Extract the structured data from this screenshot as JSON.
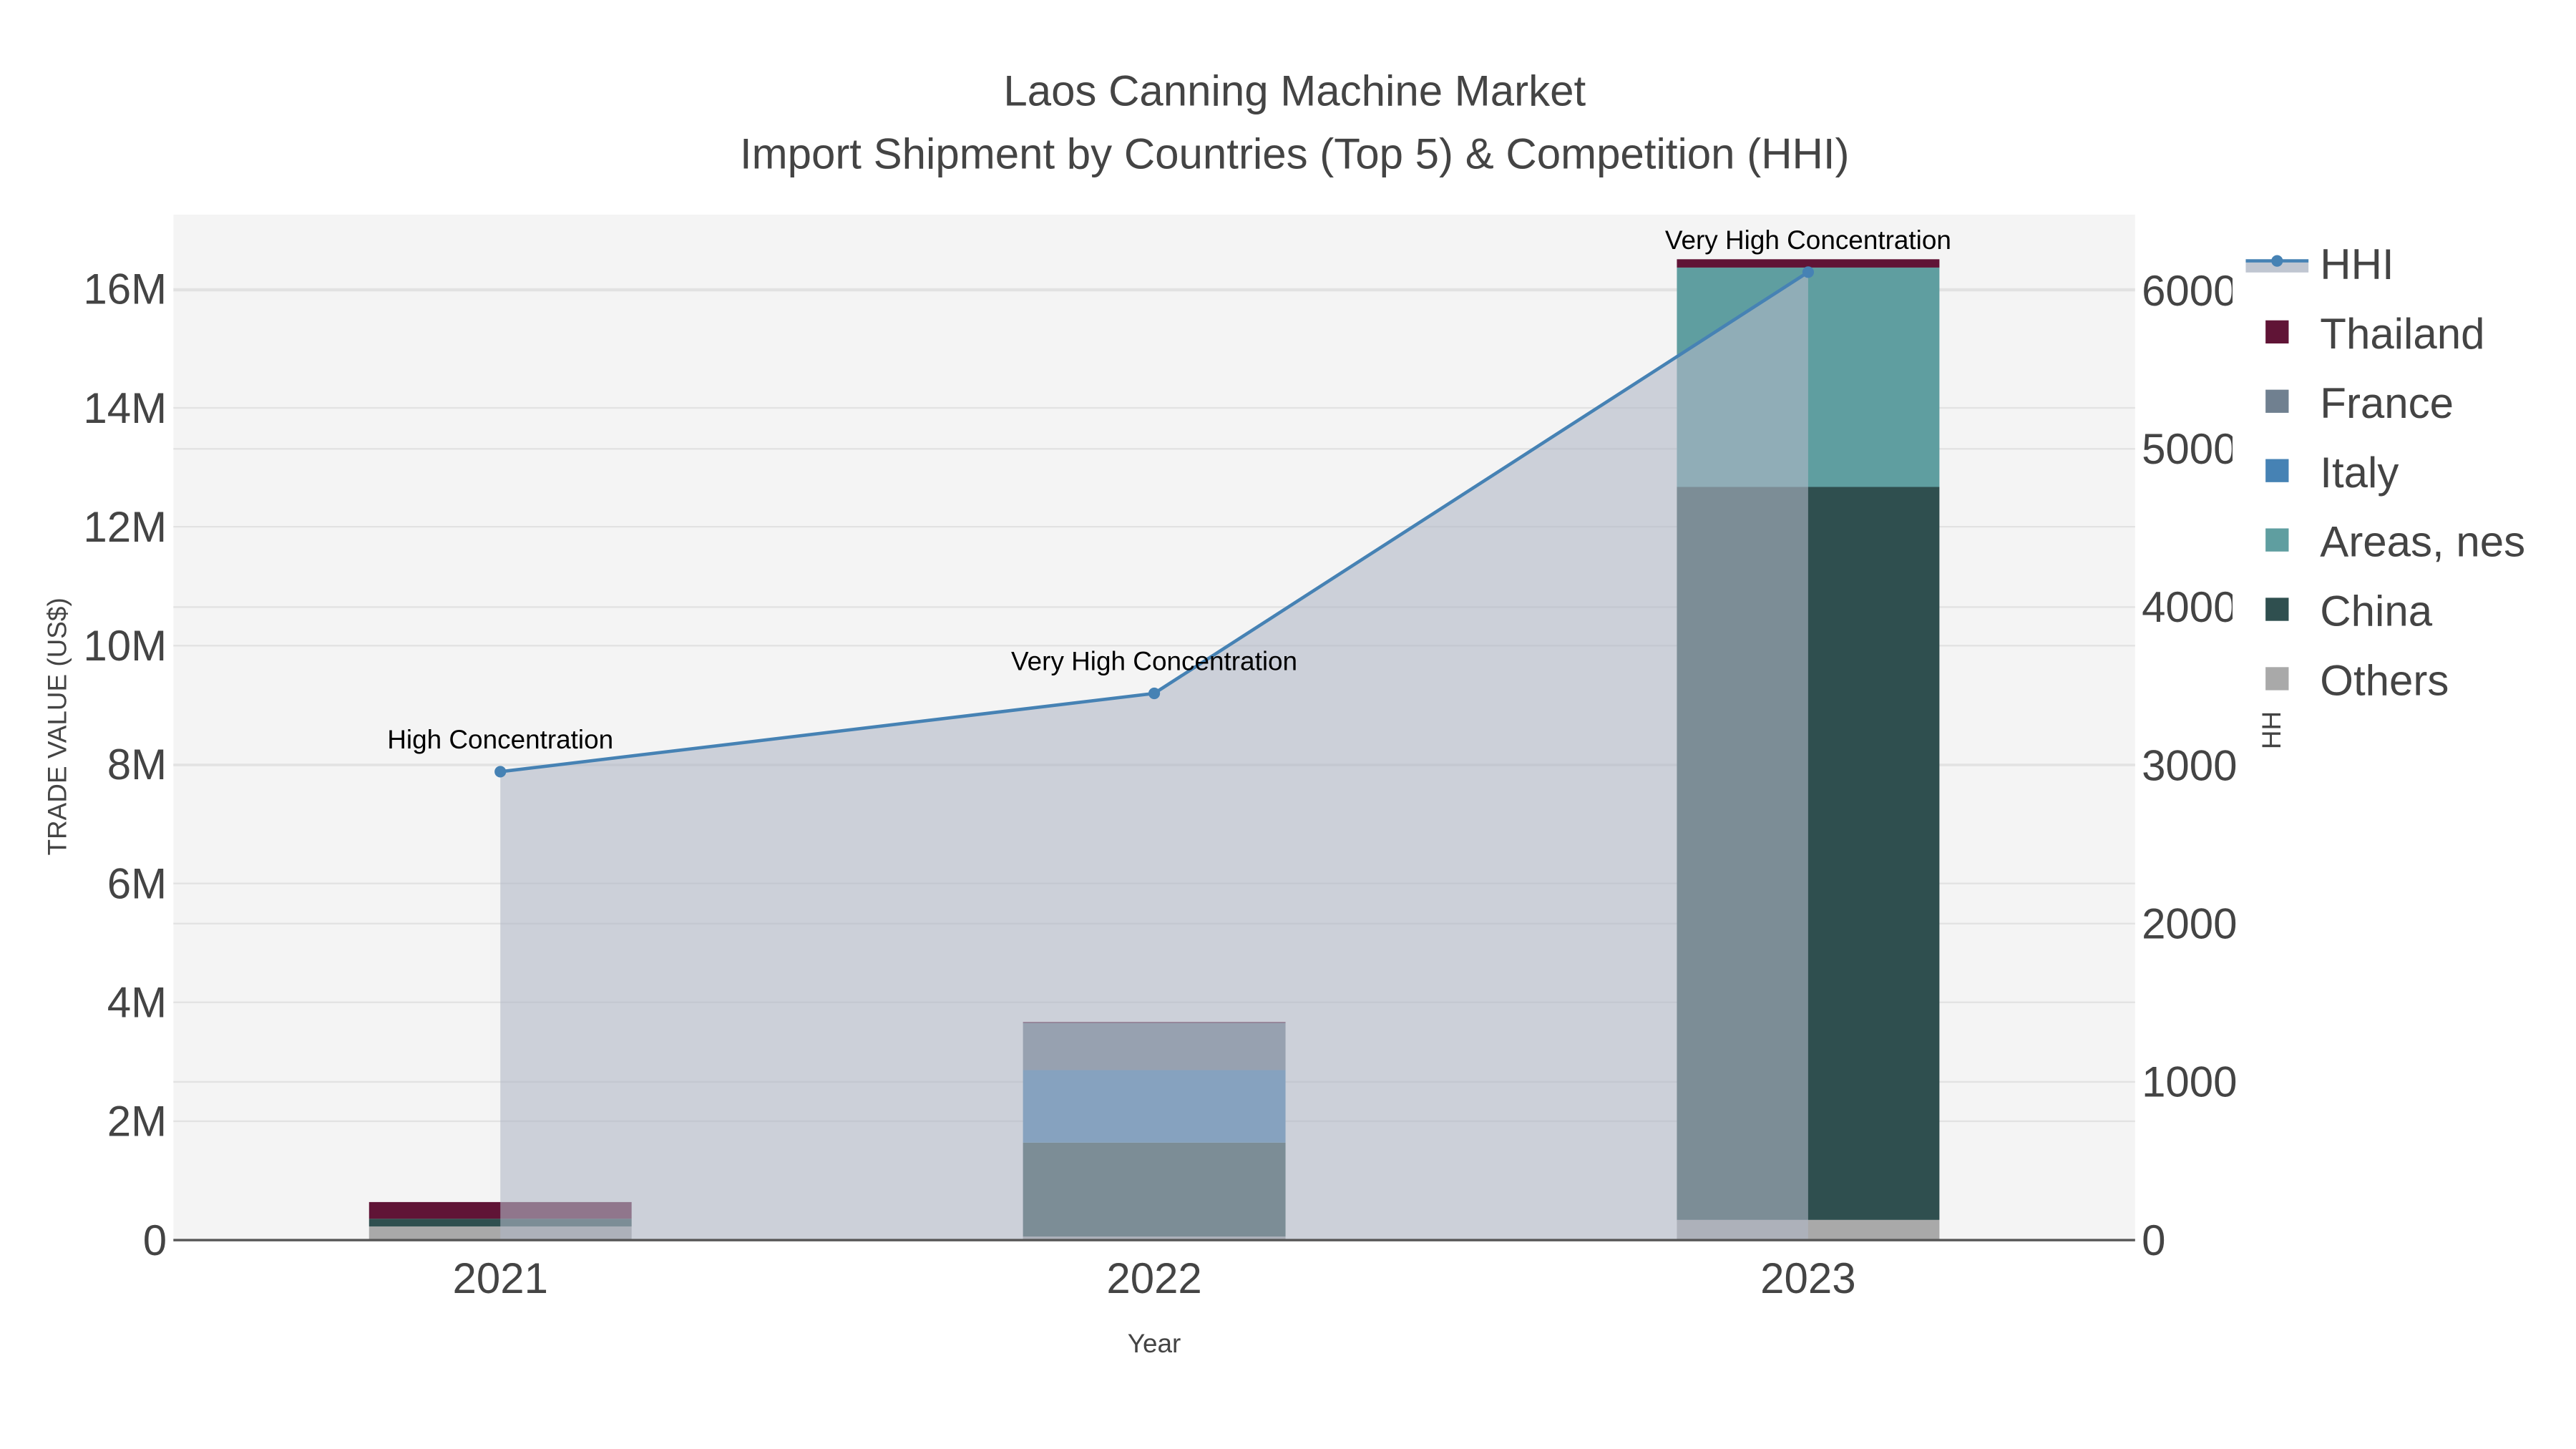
{
  "chart_data": {
    "type": "bar",
    "title_line1": "Laos Canning Machine Market",
    "title_line2": "Import Shipment by Countries (Top 5) & Competition (HHI)",
    "xlabel": "Year",
    "ylabel": "TRADE VALUE (US$)",
    "y2label": "HHI",
    "categories": [
      "2021",
      "2022",
      "2023"
    ],
    "ylim": [
      0,
      17250000
    ],
    "y2lim": [
      0,
      6480
    ],
    "yticks": [
      0,
      2000000,
      4000000,
      6000000,
      8000000,
      10000000,
      12000000,
      14000000,
      16000000
    ],
    "ytick_labels": [
      "0",
      "2M",
      "4M",
      "6M",
      "8M",
      "10M",
      "12M",
      "14M",
      "16M"
    ],
    "y2ticks": [
      0,
      1000,
      2000,
      3000,
      4000,
      5000,
      6000
    ],
    "y2tick_labels": [
      "0",
      "1000",
      "2000",
      "3000",
      "4000",
      "5000",
      "6000"
    ],
    "series": [
      {
        "name": "Others",
        "color": "#A9A9A9",
        "values": [
          230000,
          60000,
          340000
        ]
      },
      {
        "name": "China",
        "color": "#2F4F4F",
        "values": [
          130000,
          1580000,
          12330000
        ]
      },
      {
        "name": "Areas, nes",
        "color": "#5F9EA0",
        "values": [
          0,
          0,
          3690000
        ]
      },
      {
        "name": "Italy",
        "color": "#4682B4",
        "values": [
          0,
          1220000,
          0
        ]
      },
      {
        "name": "France",
        "color": "#708090",
        "values": [
          0,
          800000,
          0
        ]
      },
      {
        "name": "Thailand",
        "color": "#601436",
        "values": [
          280000,
          10000,
          140000
        ]
      }
    ],
    "hhi": {
      "name": "HHI",
      "color": "#4682B4",
      "values": [
        2960,
        3455,
        6117
      ]
    },
    "annotations": [
      "High Concentration",
      "Very High Concentration",
      "Very High Concentration"
    ],
    "legend_order": [
      "HHI",
      "Thailand",
      "France",
      "Italy",
      "Areas, nes",
      "China",
      "Others"
    ],
    "legend_placement": "right",
    "grid": true
  }
}
